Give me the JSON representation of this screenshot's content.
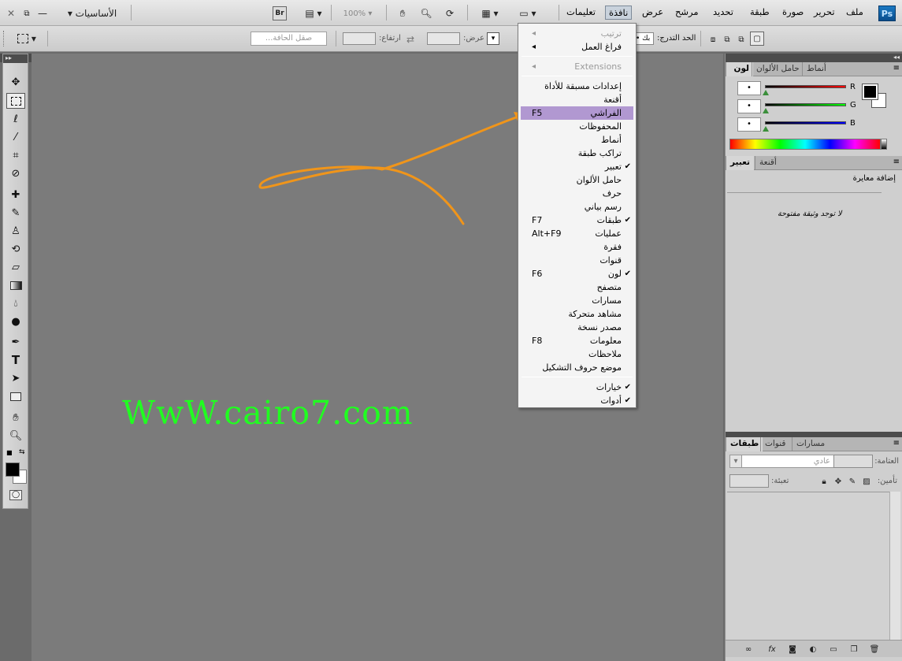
{
  "app": {
    "logo": "Ps",
    "workspace_label": "الأساسيات",
    "zoom": "100%",
    "bridge_label": "Br"
  },
  "menubar": {
    "items": [
      "ملف",
      "تحرير",
      "صورة",
      "طبقة",
      "تحديد",
      "مرشح",
      "عرض",
      "نافذة",
      "تعليمات"
    ],
    "active": "نافذة"
  },
  "options": {
    "refine_edge": "صقل الحافة...",
    "height_label": "ارتفاع:",
    "width_label": "عرض:",
    "style_label": "الحد التدرج:",
    "style_value": "• بك"
  },
  "window_menu": {
    "items": [
      {
        "label": "ترتيب",
        "disabled": true,
        "submenu": true
      },
      {
        "label": "فراغ العمل",
        "submenu": true
      },
      {
        "sep": true
      },
      {
        "label": "Extensions",
        "disabled": true,
        "submenu": true
      },
      {
        "sep": true
      },
      {
        "label": "إعدادات مسبقة للأداة"
      },
      {
        "label": "أقنعة"
      },
      {
        "label": "الفراشي",
        "shortcut": "F5",
        "highlight": true
      },
      {
        "label": "المحفوظات"
      },
      {
        "label": "أنماط"
      },
      {
        "label": "تراكب طبقة"
      },
      {
        "label": "تعبير",
        "checked": true
      },
      {
        "label": "حامل الألوان"
      },
      {
        "label": "حرف"
      },
      {
        "label": "رسم بياني"
      },
      {
        "label": "طبقات",
        "shortcut": "F7",
        "checked": true
      },
      {
        "label": "عمليات",
        "shortcut": "Alt+F9"
      },
      {
        "label": "فقرة"
      },
      {
        "label": "قنوات"
      },
      {
        "label": "لون",
        "shortcut": "F6",
        "checked": true
      },
      {
        "label": "متصفح"
      },
      {
        "label": "مسارات"
      },
      {
        "label": "مشاهد متحركة"
      },
      {
        "label": "مصدر نسخة"
      },
      {
        "label": "معلومات",
        "shortcut": "F8"
      },
      {
        "label": "ملاحظات"
      },
      {
        "label": "موضع حروف التشكيل"
      },
      {
        "sep": true
      },
      {
        "label": "خيارات",
        "checked": true
      },
      {
        "label": "أدوات",
        "checked": true
      }
    ]
  },
  "color_panel": {
    "tabs": [
      "لون",
      "حامل الألوان",
      "أنماط"
    ],
    "channels": [
      {
        "name": "R",
        "value": "•",
        "color": "#d00000"
      },
      {
        "name": "G",
        "value": "•",
        "color": "#00b000"
      },
      {
        "name": "B",
        "value": "•",
        "color": "#0000c0"
      }
    ]
  },
  "adjust_panel": {
    "tabs": [
      "تعبير",
      "أقنعة"
    ],
    "add_label": "إضافة معايرة",
    "empty_msg": "لا توجد وثيقة مفتوحة"
  },
  "layers_panel": {
    "tabs": [
      "طبقات",
      "قنوات",
      "مسارات"
    ],
    "blend_value": "عادي",
    "opacity_label": "العتامة:",
    "lock_label": "تأمين:",
    "fill_label": "تعبئة:"
  },
  "watermark": "WwW.cairo7.com",
  "colors": {
    "accent_highlight": "#b198d1",
    "arrow": "#f0951a",
    "watermark": "#20ff20"
  }
}
